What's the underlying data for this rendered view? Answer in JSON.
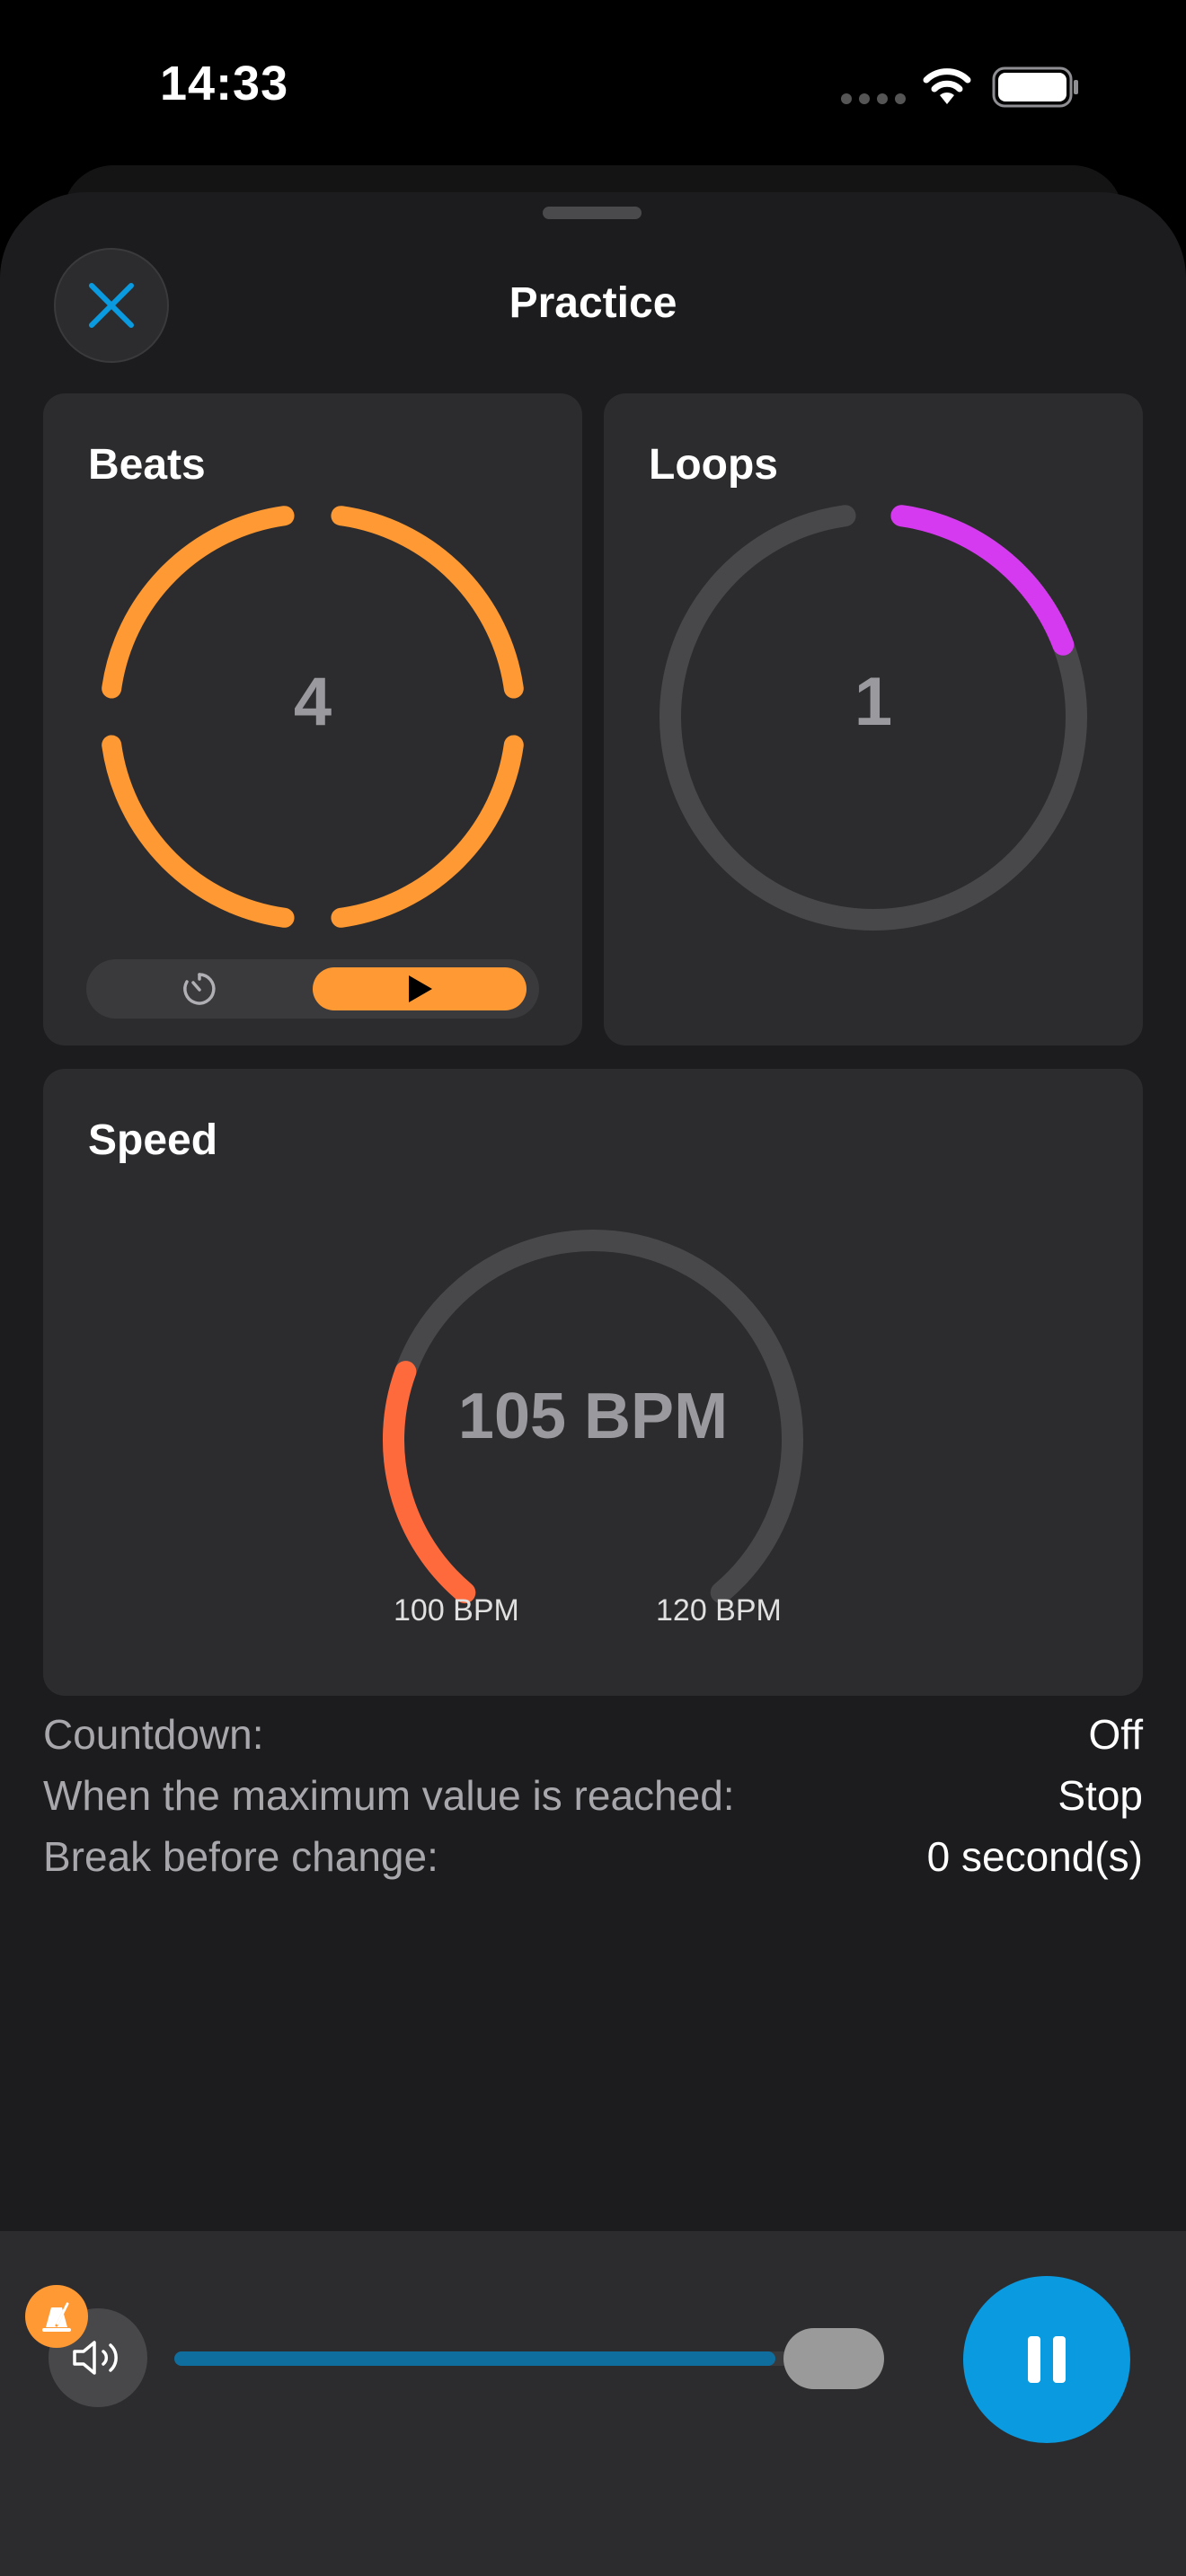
{
  "status_bar": {
    "time": "14:33"
  },
  "header": {
    "title": "Practice"
  },
  "beats": {
    "title": "Beats",
    "value": "4",
    "segments": 4,
    "active_segments": 4,
    "color": "#ff9933"
  },
  "loops": {
    "title": "Loops",
    "value": "1",
    "progress": 0.17,
    "color": "#d63af0",
    "track_color": "#48484a"
  },
  "speed": {
    "title": "Speed",
    "value_label": "105 BPM",
    "value": 105,
    "min": 100,
    "max": 120,
    "min_label": "100 BPM",
    "max_label": "120 BPM",
    "color": "#ff6a3d",
    "track_color": "#48484a"
  },
  "settings": [
    {
      "label": "Countdown:",
      "value": "Off"
    },
    {
      "label": "When the maximum value is reached:",
      "value": "Stop"
    },
    {
      "label": "Break before change:",
      "value": "0 second(s)"
    }
  ],
  "player": {
    "volume": 0.88,
    "accent": "#0a9ae0"
  },
  "icons": {
    "close": "close-icon",
    "timer": "timer-icon",
    "play": "play-icon",
    "volume": "speaker-icon",
    "warning": "warning-icon",
    "pause": "pause-icon"
  }
}
